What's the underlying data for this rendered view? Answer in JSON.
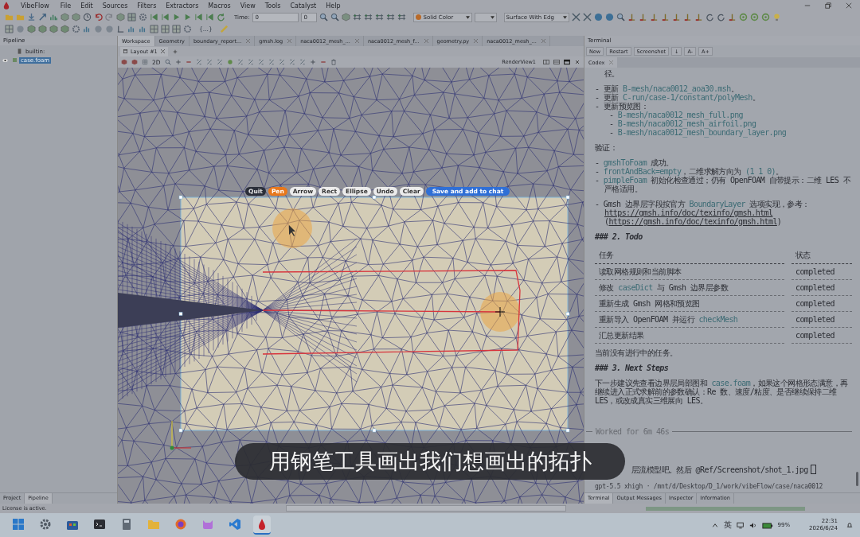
{
  "app": {
    "title": "VibeFlow"
  },
  "menu": [
    "File",
    "Edit",
    "Sources",
    "Filters",
    "Extractors",
    "Macros",
    "View",
    "Tools",
    "Catalyst",
    "Help"
  ],
  "toolbar": {
    "time_label": "Time:",
    "time_value": "0",
    "time_step": "0",
    "color_by": "Solid Color",
    "representation": "Surface With Edg",
    "script_button": "{...}"
  },
  "pipeline": {
    "title": "Pipeline",
    "items": [
      {
        "label": "builtin:",
        "selected": false,
        "children": [
          {
            "label": "case.foam",
            "selected": true
          }
        ]
      }
    ],
    "tabs": [
      {
        "label": "Project",
        "selected": false
      },
      {
        "label": "Pipeline",
        "selected": true
      }
    ]
  },
  "workspace": {
    "tabs": [
      {
        "label": "Workspace",
        "selected": true
      },
      {
        "label": "Geometry",
        "selected": false
      },
      {
        "label": "boundary_report...",
        "selected": false
      },
      {
        "label": "gmsh.log",
        "selected": false
      },
      {
        "label": "naca0012_mesh_...",
        "selected": false
      },
      {
        "label": "naca0012_mesh_f...",
        "selected": false
      },
      {
        "label": "geometry.py",
        "selected": false
      },
      {
        "label": "naca0012_mesh_...",
        "selected": false
      }
    ],
    "layout_tab": "Layout #1",
    "view_mode": "2D",
    "view_name": "RenderView1"
  },
  "annotator": {
    "buttons": [
      {
        "label": "Quit",
        "kind": "exit",
        "selected": false
      },
      {
        "label": "Pen",
        "kind": "tool",
        "selected": true
      },
      {
        "label": "Arrow",
        "kind": "tool",
        "selected": false
      },
      {
        "label": "Rect",
        "kind": "tool",
        "selected": false
      },
      {
        "label": "Ellipse",
        "kind": "tool",
        "selected": false
      },
      {
        "label": "Undo",
        "kind": "command",
        "selected": false
      },
      {
        "label": "Clear",
        "kind": "command",
        "selected": false
      },
      {
        "label": "Save and add to chat",
        "kind": "submit",
        "selected": false
      }
    ]
  },
  "caption": "用钢笔工具画出我们想画出的拓扑",
  "terminal": {
    "title": "Terminal",
    "buttons": [
      "New",
      "Restart",
      "Screenshot",
      "↓",
      "A-",
      "A+"
    ],
    "tabs": [
      {
        "label": "Codex",
        "selected": true
      }
    ],
    "blocks": [
      {
        "kind": "lines",
        "lines": [
          {
            "kind": "cont",
            "segments": [
              {
                "kind": "text",
                "text": "径。"
              }
            ]
          }
        ]
      },
      {
        "kind": "lines",
        "lines": [
          {
            "kind": "item",
            "segments": [
              {
                "kind": "text",
                "text": "- 更新 "
              },
              {
                "kind": "code",
                "text": "B-mesh/naca0012_aoa30.msh"
              },
              {
                "kind": "text",
                "text": "。"
              }
            ]
          },
          {
            "kind": "item",
            "segments": [
              {
                "kind": "text",
                "text": "- 更新 "
              },
              {
                "kind": "code",
                "text": "C-run/case-1/constant/polyMesh"
              },
              {
                "kind": "text",
                "text": "。"
              }
            ]
          },
          {
            "kind": "item",
            "segments": [
              {
                "kind": "text",
                "text": "- 更新预览图："
              }
            ]
          },
          {
            "kind": "subitem",
            "segments": [
              {
                "kind": "text",
                "text": "- "
              },
              {
                "kind": "code",
                "text": "B-mesh/naca0012_mesh_full.png"
              }
            ]
          },
          {
            "kind": "subitem",
            "segments": [
              {
                "kind": "text",
                "text": "- "
              },
              {
                "kind": "code",
                "text": "B-mesh/naca0012_mesh_airfoil.png"
              }
            ]
          },
          {
            "kind": "subitem",
            "segments": [
              {
                "kind": "text",
                "text": "- "
              },
              {
                "kind": "code",
                "text": "B-mesh/naca0012_mesh_boundary_layer.png"
              }
            ]
          }
        ]
      },
      {
        "kind": "lines",
        "lines": [
          {
            "kind": "plain",
            "segments": [
              {
                "kind": "text",
                "text": "验证："
              }
            ]
          }
        ]
      },
      {
        "kind": "lines",
        "lines": [
          {
            "kind": "item",
            "segments": [
              {
                "kind": "text",
                "text": "- "
              },
              {
                "kind": "code",
                "text": "gmshToFoam"
              },
              {
                "kind": "text",
                "text": " 成功。"
              }
            ]
          },
          {
            "kind": "item",
            "segments": [
              {
                "kind": "text",
                "text": "- "
              },
              {
                "kind": "code",
                "text": "frontAndBack=empty"
              },
              {
                "kind": "text",
                "text": "，二维求解方向为 "
              },
              {
                "kind": "code",
                "text": "(1 1 0)"
              },
              {
                "kind": "text",
                "text": "。"
              }
            ]
          },
          {
            "kind": "item",
            "segments": [
              {
                "kind": "text",
                "text": "- "
              },
              {
                "kind": "code",
                "text": "pimpleFoam"
              },
              {
                "kind": "text",
                "text": " 初始化检查通过；仍有 OpenFOAM 自带提示：二维 LES 不严格适用。"
              }
            ]
          }
        ]
      },
      {
        "kind": "lines",
        "lines": [
          {
            "kind": "item",
            "segments": [
              {
                "kind": "text",
                "text": "- Gmsh 边界层字段按官方 "
              },
              {
                "kind": "code",
                "text": "BoundaryLayer"
              },
              {
                "kind": "text",
                "text": " 选项实现，参考："
              },
              {
                "kind": "link",
                "text": "https://gmsh.info/doc/texinfo/gmsh.html"
              },
              {
                "kind": "text",
                "text": " ("
              },
              {
                "kind": "link",
                "text": "https://gmsh.info/doc/texinfo/gmsh.html"
              },
              {
                "kind": "text",
                "text": ")"
              }
            ]
          }
        ]
      },
      {
        "kind": "lines",
        "lines": [
          {
            "kind": "heading",
            "segments": [
              {
                "kind": "text",
                "text": "### 2. Todo"
              }
            ]
          }
        ]
      },
      {
        "kind": "table",
        "columns": [
          "任务",
          "状态"
        ],
        "rows": [
          {
            "task": [
              {
                "kind": "text",
                "text": "读取网格规则和当前脚本"
              }
            ],
            "status": "completed"
          },
          {
            "task": [
              {
                "kind": "text",
                "text": "修改 "
              },
              {
                "kind": "code",
                "text": "caseDict"
              },
              {
                "kind": "text",
                "text": " 与 Gmsh 边界层参数"
              }
            ],
            "status": "completed"
          },
          {
            "task": [
              {
                "kind": "text",
                "text": "重新生成 Gmsh 网格和预览图"
              }
            ],
            "status": "completed"
          },
          {
            "task": [
              {
                "kind": "text",
                "text": "重新导入 OpenFOAM 并运行 "
              },
              {
                "kind": "code",
                "text": "checkMesh"
              }
            ],
            "status": "completed"
          },
          {
            "task": [
              {
                "kind": "text",
                "text": "汇总更新结果"
              }
            ],
            "status": "completed"
          }
        ]
      },
      {
        "kind": "lines",
        "lines": [
          {
            "kind": "plain",
            "segments": [
              {
                "kind": "text",
                "text": "当前没有进行中的任务。"
              }
            ]
          }
        ]
      },
      {
        "kind": "lines",
        "lines": [
          {
            "kind": "heading",
            "segments": [
              {
                "kind": "text",
                "text": "### 3. Next Steps"
              }
            ]
          }
        ]
      },
      {
        "kind": "lines",
        "lines": [
          {
            "kind": "plain",
            "segments": [
              {
                "kind": "text",
                "text": "下一步建议先查看边界层局部图和 "
              },
              {
                "kind": "code",
                "text": "case.foam"
              },
              {
                "kind": "text",
                "text": "，如果这个网格形态满意，再继续进入正式求解前的参数确认：Re 数、速度/粘度、是否继续保持二维 LES，或改成真实三维展向 LES。"
              }
            ]
          }
        ]
      }
    ],
    "worked": "Worked for 6m 46s",
    "prompt": "层流模型吧。然后 @Ref/Screenshot/shot_1.jpg",
    "footer": "gpt-5.5 xhigh · /mnt/d/Desktop/D_1/work/vibeFlow/case/naca0012",
    "bottom_tabs": [
      {
        "label": "Terminal",
        "selected": true
      },
      {
        "label": "Output Messages",
        "selected": false
      },
      {
        "label": "Inspector",
        "selected": false
      },
      {
        "label": "Information",
        "selected": false
      }
    ]
  },
  "status_bar": "License is active.",
  "taskbar": {
    "language": "英",
    "battery": "99%",
    "time": "22:31",
    "date": "2026/6/24"
  }
}
